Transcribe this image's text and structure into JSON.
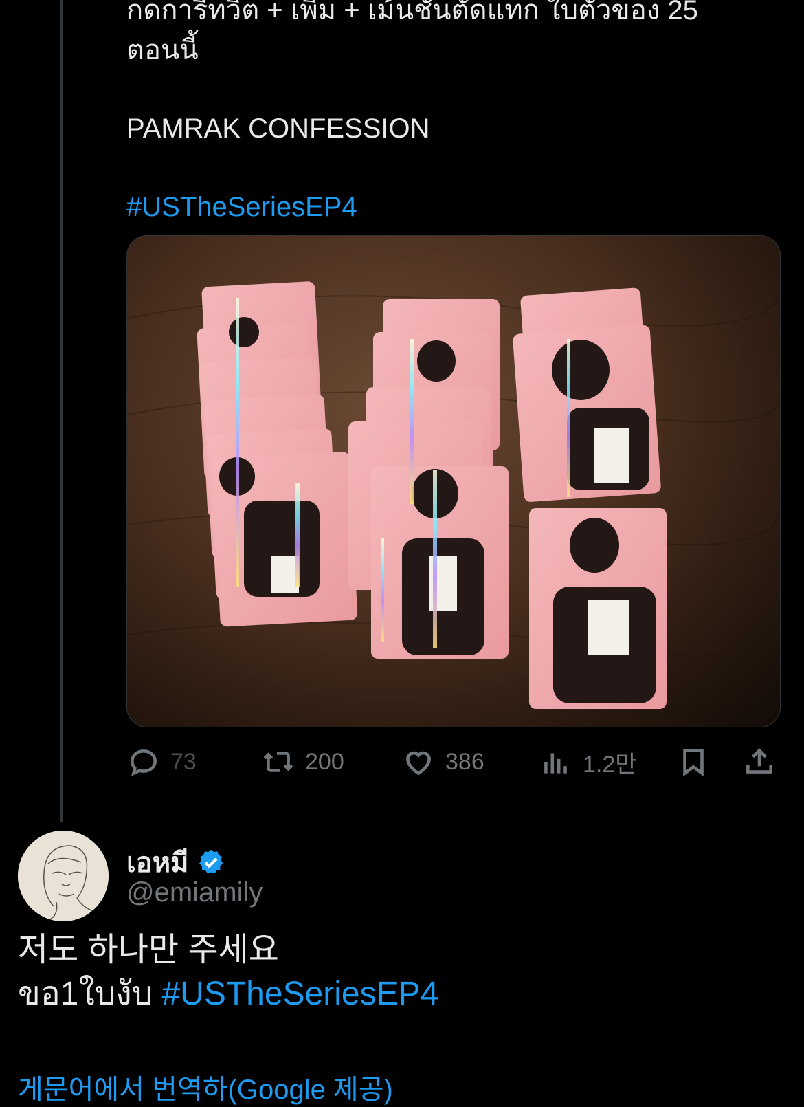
{
  "tweet": {
    "text_lines": [
      "กดการีทวิต + เพิ่ม + เม้นชั้นตัดแทก ใบตัวของ 25",
      "ตอนนี้"
    ],
    "text_title": "PAMRAK CONFESSION",
    "hashtag": "#USTheSeriesEP4",
    "stats": {
      "replies": "73",
      "retweets": "200",
      "likes": "386",
      "views": "1.2만"
    }
  },
  "reply": {
    "author_name": "เอหมี",
    "handle": "@emiamily",
    "line1": "저도 하나만 주세요",
    "line2_text": "ขอ1ใบงับ ",
    "line2_hashtag": "#USTheSeriesEP4",
    "translate_link": "게문어에서 번역하(Google 제공)"
  },
  "icons": {
    "reply": "reply-icon",
    "retweet": "retweet-icon",
    "like": "heart-icon",
    "views": "views-icon",
    "bookmark": "bookmark-icon",
    "share": "share-icon",
    "verified": "verified-badge-icon"
  },
  "colors": {
    "background": "#000000",
    "text": "#e7e9ea",
    "muted": "#71767b",
    "accent": "#1d9bf0"
  }
}
